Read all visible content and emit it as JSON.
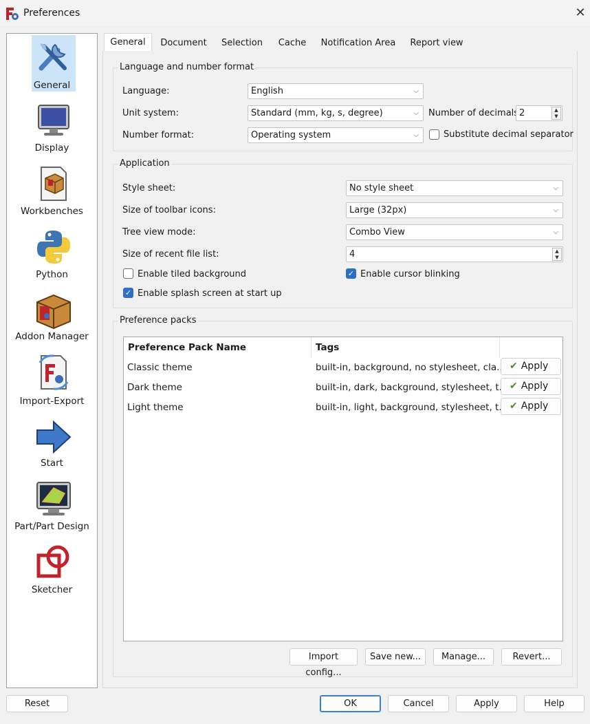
{
  "window": {
    "title": "Preferences",
    "close_glyph": "✕"
  },
  "sidebar": {
    "items": [
      {
        "label": "General",
        "icon": "tools-icon",
        "selected": true
      },
      {
        "label": "Display",
        "icon": "monitor-icon"
      },
      {
        "label": "Workbenches",
        "icon": "workbenches-icon"
      },
      {
        "label": "Python",
        "icon": "python-icon"
      },
      {
        "label": "Addon Manager",
        "icon": "addon-box-icon"
      },
      {
        "label": "Import-Export",
        "icon": "import-export-icon"
      },
      {
        "label": "Start",
        "icon": "arrow-right-icon"
      },
      {
        "label": "Part/Part Design",
        "icon": "part-design-icon"
      },
      {
        "label": "Sketcher",
        "icon": "sketcher-icon"
      }
    ]
  },
  "tabs": [
    {
      "label": "General",
      "active": true
    },
    {
      "label": "Document"
    },
    {
      "label": "Selection"
    },
    {
      "label": "Cache"
    },
    {
      "label": "Notification Area"
    },
    {
      "label": "Report view"
    }
  ],
  "language_group": {
    "title": "Language and number format",
    "language_label": "Language:",
    "language_value": "English",
    "unit_label": "Unit system:",
    "unit_value": "Standard (mm, kg, s, degree)",
    "decimals_label": "Number of decimals:",
    "decimals_value": "2",
    "number_format_label": "Number format:",
    "number_format_value": "Operating system",
    "substitute_label": "Substitute decimal separator",
    "substitute_checked": false
  },
  "application_group": {
    "title": "Application",
    "style_sheet_label": "Style sheet:",
    "style_sheet_value": "No style sheet",
    "toolbar_icons_label": "Size of toolbar icons:",
    "toolbar_icons_value": "Large (32px)",
    "tree_view_label": "Tree view mode:",
    "tree_view_value": "Combo View",
    "recent_files_label": "Size of recent file list:",
    "recent_files_value": "4",
    "tiled_bg_label": "Enable tiled background",
    "tiled_bg_checked": false,
    "cursor_blink_label": "Enable cursor blinking",
    "cursor_blink_checked": true,
    "splash_label": "Enable splash screen at start up",
    "splash_checked": true
  },
  "packs_group": {
    "title": "Preference packs",
    "col_name": "Preference Pack Name",
    "col_tags": "Tags",
    "rows": [
      {
        "name": "Classic theme",
        "tags": "built-in, background, no stylesheet, cla...",
        "apply": "Apply"
      },
      {
        "name": "Dark theme",
        "tags": "built-in, dark, background, stylesheet, t...",
        "apply": "Apply"
      },
      {
        "name": "Light theme",
        "tags": "built-in, light, background, stylesheet, t...",
        "apply": "Apply"
      }
    ],
    "import_label": "Import config...",
    "save_new_label": "Save new...",
    "manage_label": "Manage...",
    "revert_label": "Revert..."
  },
  "footer": {
    "reset": "Reset",
    "ok": "OK",
    "cancel": "Cancel",
    "apply": "Apply",
    "help": "Help"
  },
  "colors": {
    "accent": "#2d6fc4",
    "selection": "#cce4f7",
    "apply_check": "#4f8a2b"
  }
}
